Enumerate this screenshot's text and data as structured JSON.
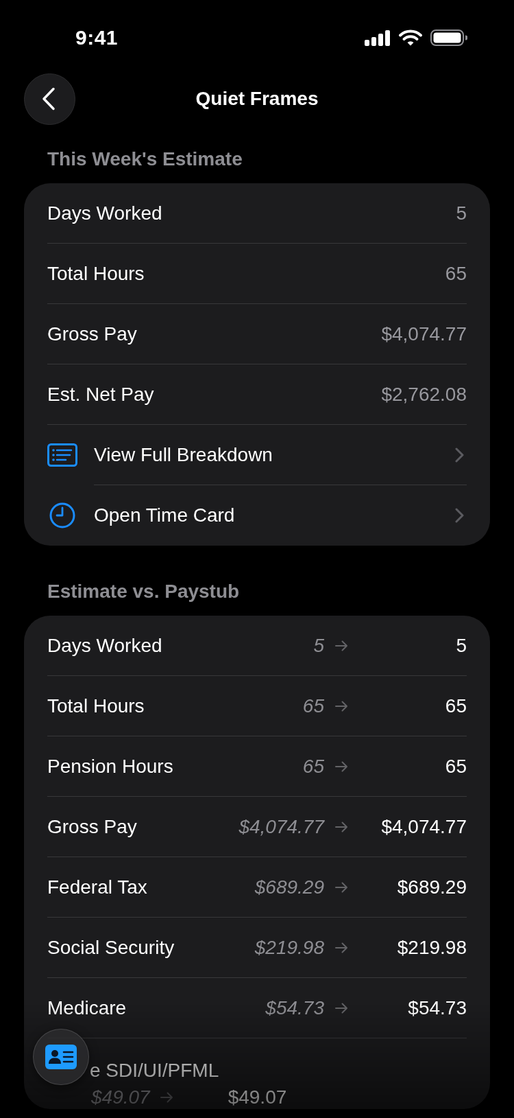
{
  "status_bar": {
    "time": "9:41"
  },
  "nav": {
    "title": "Quiet Frames"
  },
  "sections": [
    {
      "header": "This Week's Estimate",
      "rows": [
        {
          "kind": "value",
          "label": "Days Worked",
          "value": "5"
        },
        {
          "kind": "value",
          "label": "Total Hours",
          "value": "65"
        },
        {
          "kind": "value",
          "label": "Gross Pay",
          "value": "$4,074.77"
        },
        {
          "kind": "value",
          "label": "Est. Net Pay",
          "value": "$2,762.08"
        },
        {
          "kind": "link",
          "label": "View Full Breakdown"
        },
        {
          "kind": "link",
          "label": "Open Time Card"
        }
      ]
    },
    {
      "header": "Estimate vs. Paystub",
      "rows": [
        {
          "kind": "compare",
          "label": "Days Worked",
          "estimate": "5",
          "paystub": "5"
        },
        {
          "kind": "compare",
          "label": "Total Hours",
          "estimate": "65",
          "paystub": "65"
        },
        {
          "kind": "compare",
          "label": "Pension Hours",
          "estimate": "65",
          "paystub": "65"
        },
        {
          "kind": "compare",
          "label": "Gross Pay",
          "estimate": "$4,074.77",
          "paystub": "$4,074.77"
        },
        {
          "kind": "compare",
          "label": "Federal Tax",
          "estimate": "$689.29",
          "paystub": "$689.29"
        },
        {
          "kind": "compare",
          "label": "Social Security",
          "estimate": "$219.98",
          "paystub": "$219.98"
        },
        {
          "kind": "compare",
          "label": "Medicare",
          "estimate": "$54.73",
          "paystub": "$54.73"
        },
        {
          "kind": "stacked",
          "label": "e SDI/UI/PFML",
          "estimate": "$49.07",
          "paystub": "$49.07"
        }
      ]
    }
  ]
}
